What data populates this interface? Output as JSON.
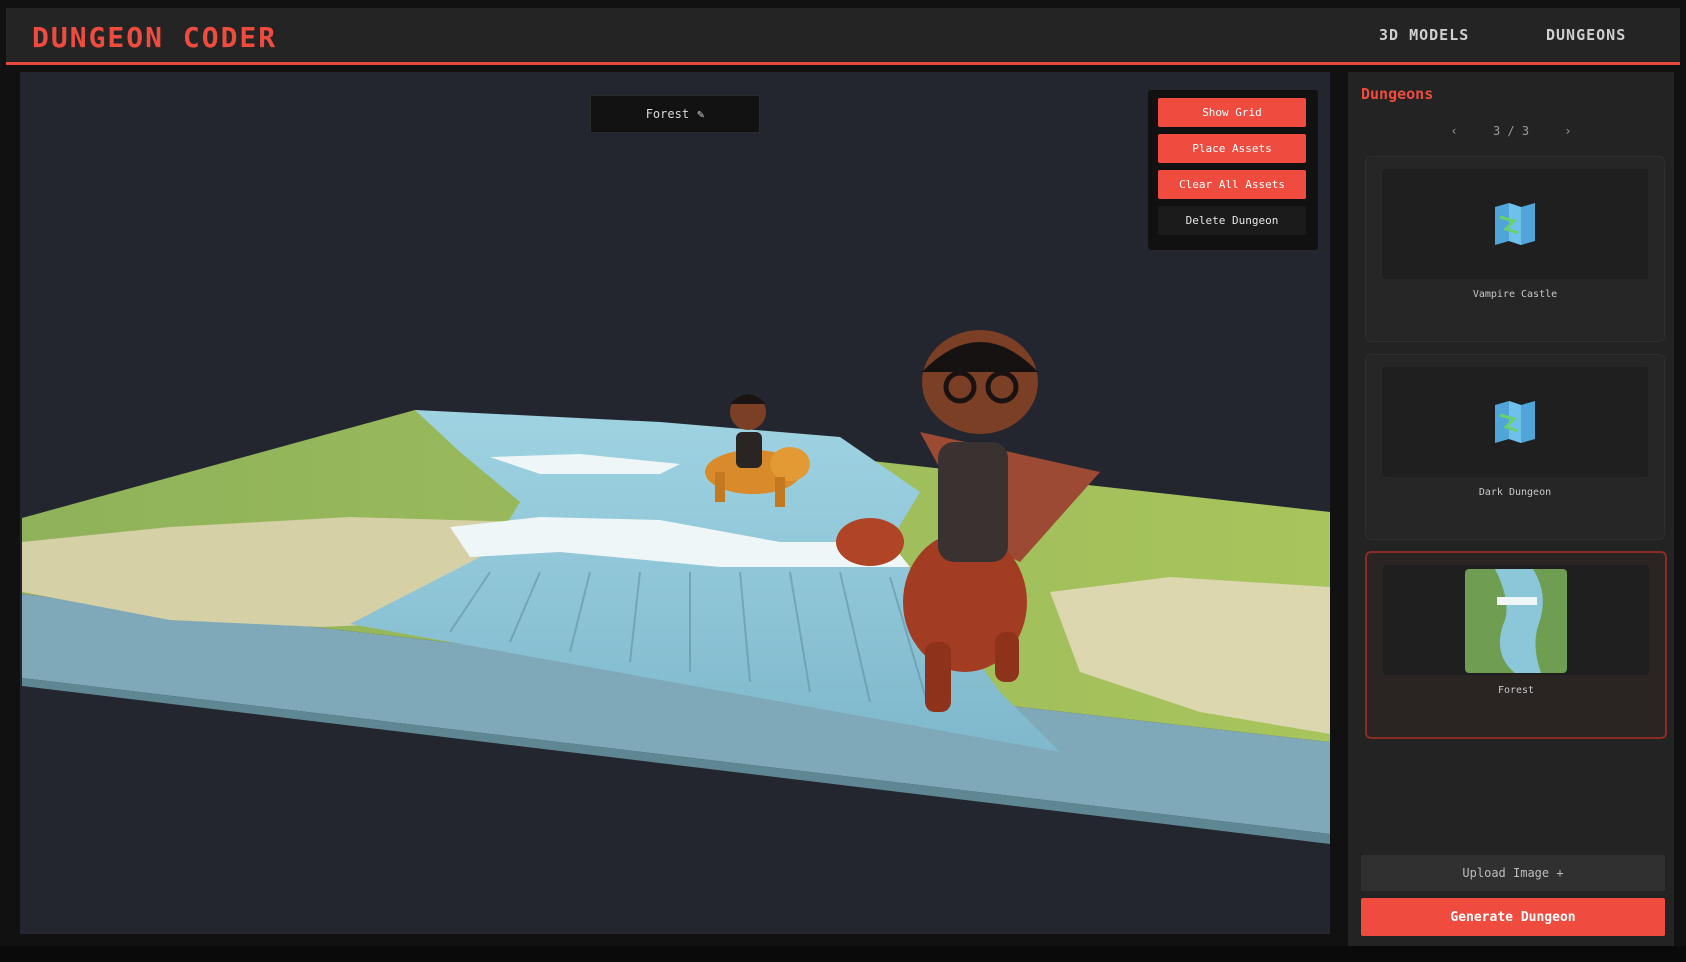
{
  "app": {
    "logo": "DUNGEON CODER",
    "nav": [
      "3D MODELS",
      "DUNGEONS"
    ]
  },
  "viewport": {
    "dungeon_name": "Forest",
    "edit_icon": "pencil-icon",
    "controls": [
      "Show Grid",
      "Place Assets",
      "Clear All Assets",
      "Delete Dungeon"
    ]
  },
  "sidebar": {
    "title": "Dungeons",
    "pager": {
      "prev": "‹",
      "page": "3 / 3",
      "next": "›"
    },
    "cards": [
      {
        "label": "Vampire Castle",
        "icon": "map-icon",
        "selected": false
      },
      {
        "label": "Dark Dungeon",
        "icon": "map-icon",
        "selected": false
      },
      {
        "label": "Forest",
        "icon": "forest-map-thumbnail",
        "selected": true
      }
    ],
    "upload_label": "Upload Image +",
    "generate_label": "Generate Dungeon"
  },
  "colors": {
    "accent": "#ef4c3f",
    "panel": "#232323",
    "viewport_bg": "#23262f"
  }
}
